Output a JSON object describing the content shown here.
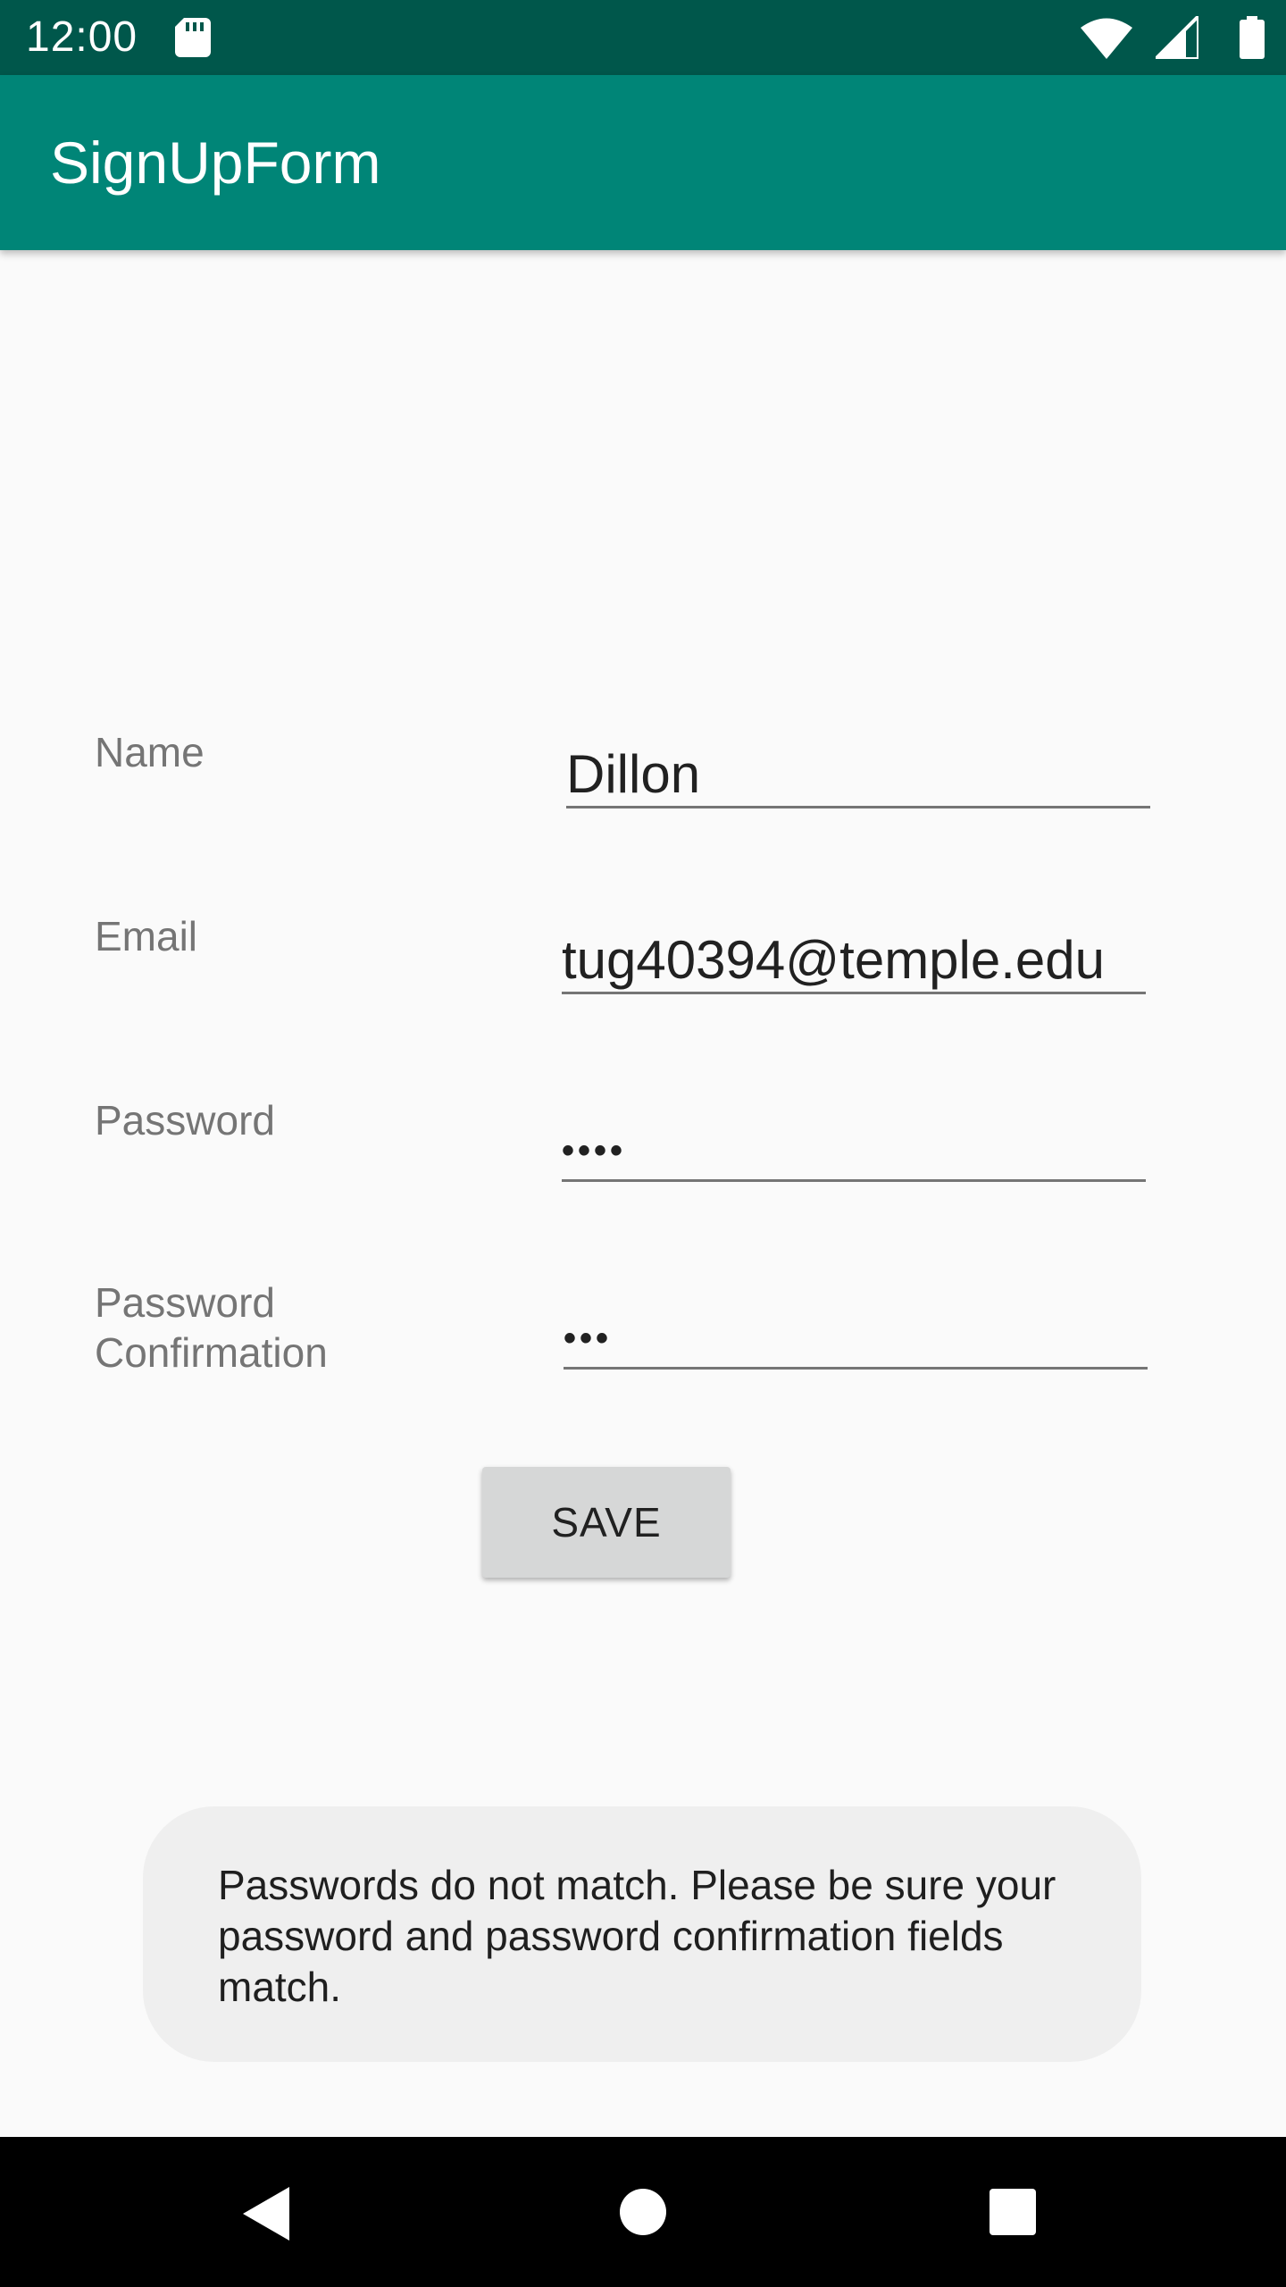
{
  "status_bar": {
    "time": "12:00",
    "icons": [
      "sd-card-icon",
      "wifi-icon",
      "signal-icon",
      "battery-icon"
    ]
  },
  "app_bar": {
    "title": "SignUpForm",
    "color": "#008577"
  },
  "form": {
    "name": {
      "label": "Name",
      "value": "Dillon"
    },
    "email": {
      "label": "Email",
      "value": "tug40394@temple.edu"
    },
    "password": {
      "label": "Password",
      "value": "••••"
    },
    "password_confirmation": {
      "label": "Password Confirmation",
      "value": "•••"
    },
    "save_label": "SAVE"
  },
  "toast": {
    "message": "Passwords do not match. Please be sure your password and password confirmation fields match."
  },
  "nav_bar": {
    "icons": [
      "back-icon",
      "home-icon",
      "recents-icon"
    ]
  },
  "colors": {
    "status_bar": "#00574b",
    "app_bar": "#008577",
    "background": "#fafafa",
    "toast_background": "#efefef"
  }
}
